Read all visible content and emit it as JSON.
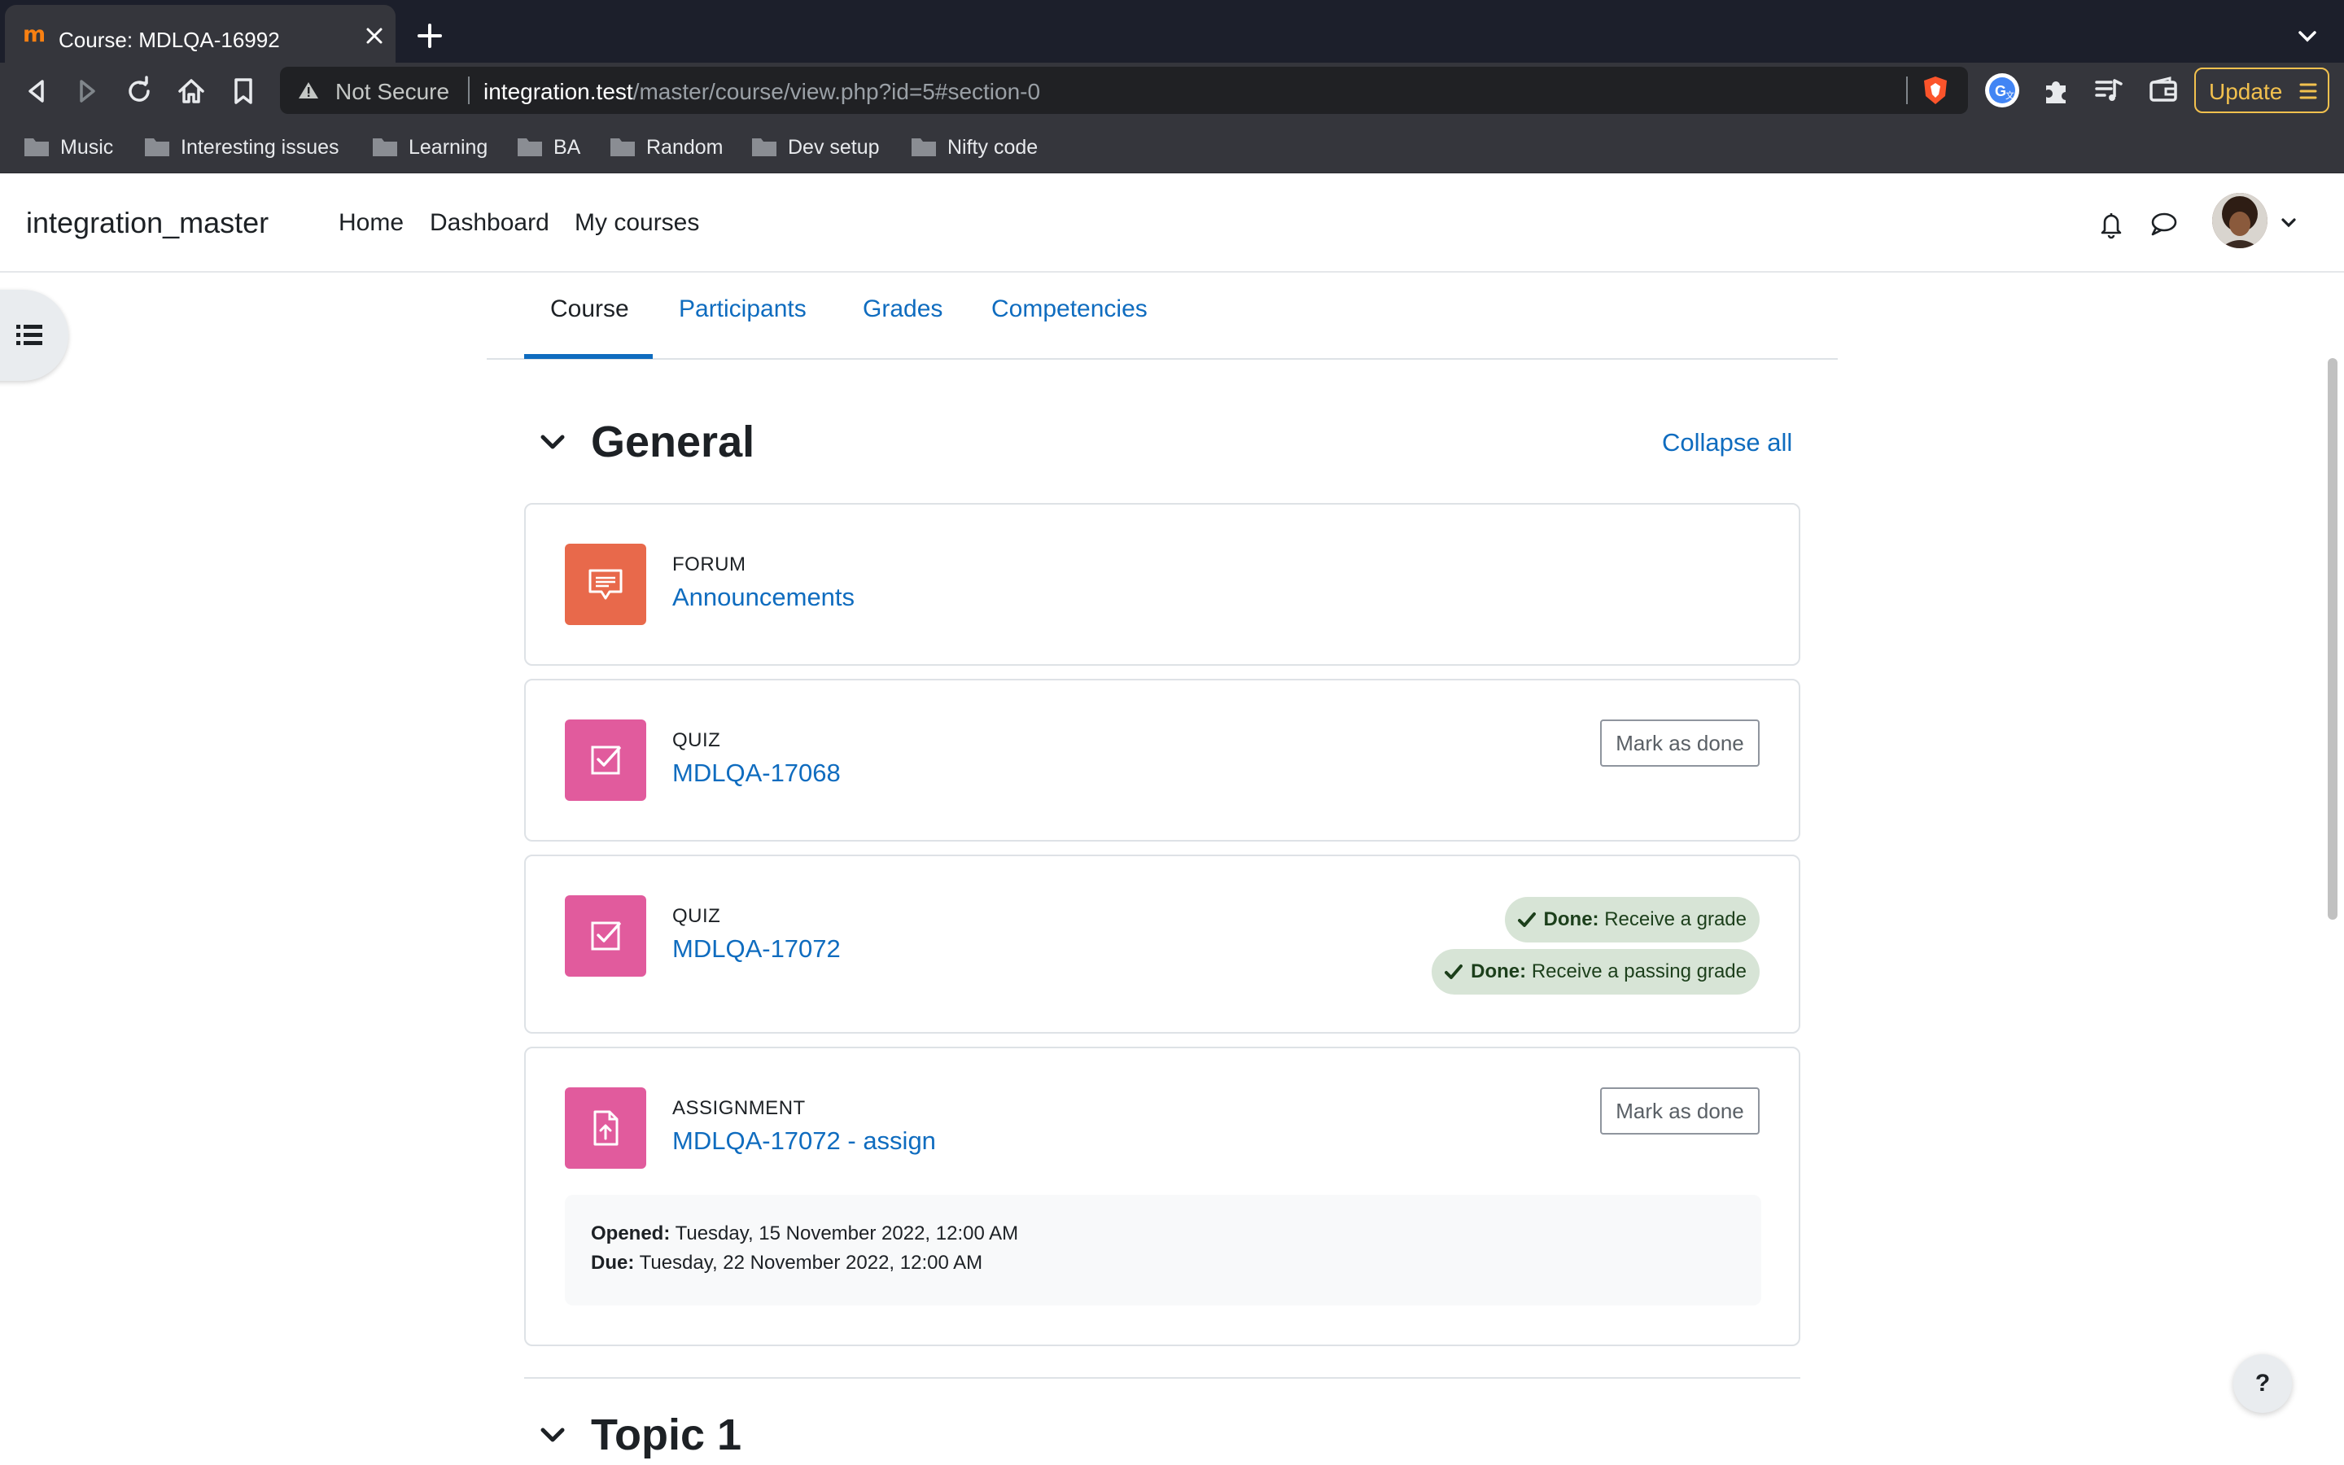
{
  "browser": {
    "tab_title": "Course: MDLQA-16992",
    "omnibox": {
      "security_label": "Not Secure",
      "url_host": "integration.test",
      "url_path": "/master/course/view.php?id=5#section-0"
    },
    "update_label": "Update",
    "bookmarks": [
      "Music",
      "Interesting issues",
      "Learning",
      "BA",
      "Random",
      "Dev setup",
      "Nifty code"
    ]
  },
  "site": {
    "name": "integration_master",
    "primary_nav": [
      "Home",
      "Dashboard",
      "My courses"
    ]
  },
  "secondary_nav": {
    "tabs": [
      "Course",
      "Participants",
      "Grades",
      "Competencies"
    ],
    "active": "Course"
  },
  "sections": {
    "general": {
      "title": "General",
      "collapse_all": "Collapse all"
    },
    "topic1": {
      "title": "Topic 1"
    }
  },
  "activities": [
    {
      "type": "FORUM",
      "name": "Announcements",
      "icon": "forum-icon",
      "icon_color": "#e8694b"
    },
    {
      "type": "QUIZ",
      "name": "MDLQA-17068",
      "icon": "quiz-icon",
      "icon_color": "#e15b9d",
      "completion_button": "Mark as done"
    },
    {
      "type": "QUIZ",
      "name": "MDLQA-17072",
      "icon": "quiz-icon",
      "icon_color": "#e15b9d",
      "completion": [
        {
          "label": "Done:",
          "text": "Receive a grade"
        },
        {
          "label": "Done:",
          "text": "Receive a passing grade"
        }
      ]
    },
    {
      "type": "ASSIGNMENT",
      "name": "MDLQA-17072 - assign",
      "icon": "assignment-icon",
      "icon_color": "#e15b9d",
      "completion_button": "Mark as done",
      "dates": [
        {
          "label": "Opened:",
          "value": "Tuesday, 15 November 2022, 12:00 AM"
        },
        {
          "label": "Due:",
          "value": "Tuesday, 22 November 2022, 12:00 AM"
        }
      ]
    }
  ],
  "help_label": "?",
  "colors": {
    "link": "#0f6cbf",
    "forum": "#e8694b",
    "quiz_assign": "#e15b9d",
    "done_badge": "#d7e4d6"
  }
}
